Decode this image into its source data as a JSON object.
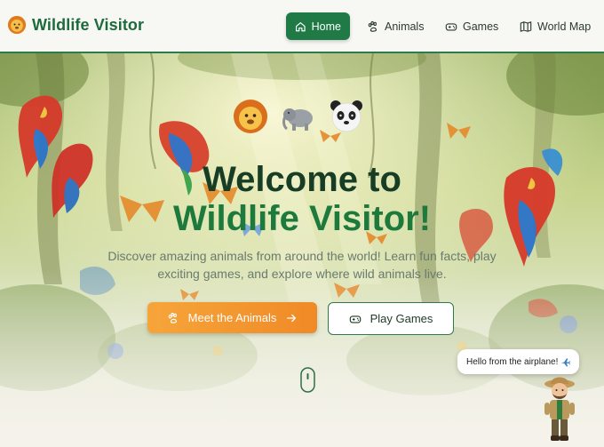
{
  "nav": {
    "brand": {
      "title": "Wildlife Visitor",
      "logo_icon": "lion-face-icon"
    },
    "items": [
      {
        "label": "Home",
        "icon": "home-icon",
        "active": true
      },
      {
        "label": "Animals",
        "icon": "paw-icon",
        "active": false
      },
      {
        "label": "Games",
        "icon": "gamepad-icon",
        "active": false
      },
      {
        "label": "World Map",
        "icon": "map-icon",
        "active": false
      }
    ]
  },
  "hero": {
    "emojis": [
      "lion-face-icon",
      "elephant-icon",
      "panda-face-icon"
    ],
    "title_line1": "Welcome to",
    "title_line2": "Wildlife Visitor!",
    "subtitle": "Discover amazing animals from around the world! Learn fun facts, play exciting games, and explore where wild animals live.",
    "primary_button": {
      "label": "Meet the Animals",
      "icon": "paw-icon",
      "trailing_icon": "arrow-right-icon"
    },
    "secondary_button": {
      "label": "Play Games",
      "icon": "gamepad-icon"
    },
    "scroll_indicator_icon": "mouse-scroll-icon"
  },
  "guide": {
    "bubble_text": "Hello from the airplane!",
    "bubble_icon": "airplane-icon",
    "avatar_icon": "explorer-guide-icon"
  },
  "colors": {
    "brand_green": "#1d6a3c",
    "nav_active": "#1f7a46",
    "cta_orange": "#f08a26",
    "headline_dark": "#173d25",
    "headline_green": "#1d7a3c"
  }
}
